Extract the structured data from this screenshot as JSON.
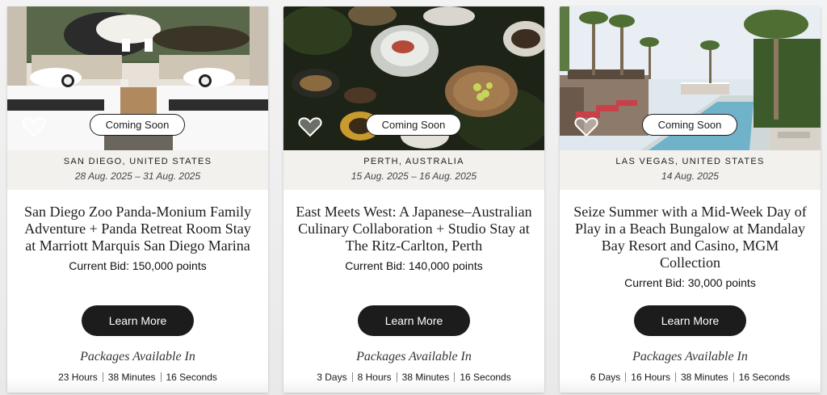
{
  "cards": [
    {
      "location": "SAN DIEGO, UNITED STATES",
      "dates": "28 Aug. 2025 – 31 Aug. 2025",
      "badge": "Coming Soon",
      "title": "San Diego Zoo Panda-Monium Family Adventure + Panda Retreat Room Stay at Marriott Marquis San Diego Marina",
      "bid": "Current Bid: 150,000 points",
      "button": "Learn More",
      "packages_label": "Packages Available In",
      "timer": [
        "23 Hours",
        "38 Minutes",
        "16 Seconds"
      ]
    },
    {
      "location": "PERTH, AUSTRALIA",
      "dates": "15 Aug. 2025 – 16 Aug. 2025",
      "badge": "Coming Soon",
      "title": "East Meets West: A Japanese–Australian Culinary Collaboration + Studio Stay at The Ritz-Carlton, Perth",
      "bid": "Current Bid: 140,000 points",
      "button": "Learn More",
      "packages_label": "Packages Available In",
      "timer": [
        "3 Days",
        "8 Hours",
        "38 Minutes",
        "16 Seconds"
      ]
    },
    {
      "location": "LAS VEGAS, UNITED STATES",
      "dates": "14 Aug. 2025",
      "badge": "Coming Soon",
      "title": "Seize Summer with a Mid-Week Day of Play in a Beach Bungalow at Mandalay Bay Resort and Casino, MGM Collection",
      "bid": "Current Bid: 30,000 points",
      "button": "Learn More",
      "packages_label": "Packages Available In",
      "timer": [
        "6 Days",
        "16 Hours",
        "38 Minutes",
        "16 Seconds"
      ]
    }
  ]
}
